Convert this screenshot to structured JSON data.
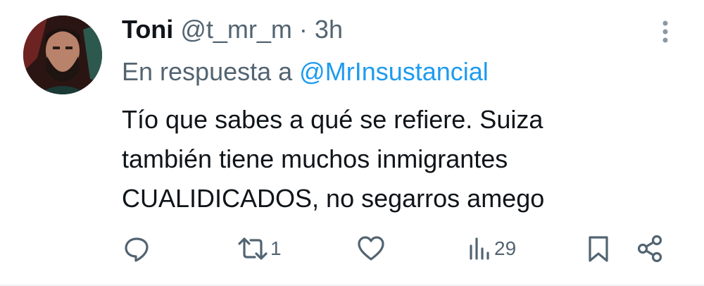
{
  "tweet": {
    "name": "Toni",
    "handle": "@t_mr_m",
    "separator": "·",
    "time": "3h",
    "reply_prefix": "En respuesta a",
    "reply_mention": "@MrInsustancial",
    "text_lines": [
      "Tío que sabes a qué se refiere. Suiza",
      "también tiene muchos inmigrantes",
      "CUALIDICADOS, no segarros amego"
    ]
  },
  "actions": {
    "reply_icon": "comment-icon",
    "retweet_icon": "retweet-icon",
    "retweet_count": "1",
    "like_icon": "heart-icon",
    "views_icon": "views-chart-icon",
    "views_count": "29",
    "bookmark_icon": "bookmark-icon",
    "share_icon": "share-icon"
  },
  "colors": {
    "text": "#0f1419",
    "secondary": "#536471",
    "link": "#1d9bf0"
  }
}
